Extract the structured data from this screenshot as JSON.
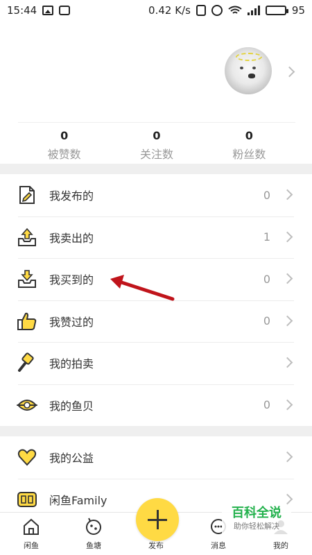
{
  "status_bar": {
    "time": "15:44",
    "speed": "0.42 K/s",
    "battery": "95"
  },
  "stats": [
    {
      "value": "0",
      "label": "被赞数"
    },
    {
      "value": "0",
      "label": "关注数"
    },
    {
      "value": "0",
      "label": "粉丝数"
    }
  ],
  "menu_group_1": [
    {
      "label": "我发布的",
      "count": "0",
      "icon": "document-edit-icon"
    },
    {
      "label": "我卖出的",
      "count": "1",
      "icon": "box-upload-icon"
    },
    {
      "label": "我买到的",
      "count": "0",
      "icon": "box-download-icon"
    },
    {
      "label": "我赞过的",
      "count": "0",
      "icon": "thumbs-up-icon"
    },
    {
      "label": "我的拍卖",
      "count": "",
      "icon": "gavel-icon"
    },
    {
      "label": "我的鱼贝",
      "count": "0",
      "icon": "shell-pearl-icon"
    }
  ],
  "menu_group_2": [
    {
      "label": "我的公益",
      "count": "",
      "icon": "heart-icon"
    },
    {
      "label": "闲鱼Family",
      "count": "",
      "icon": "family-badge-icon"
    }
  ],
  "tabbar": {
    "tabs": [
      {
        "label": "闲鱼",
        "icon": "home-icon"
      },
      {
        "label": "鱼塘",
        "icon": "pond-icon"
      },
      {
        "label": "发布",
        "icon": "plus-icon"
      },
      {
        "label": "消息",
        "icon": "message-icon"
      },
      {
        "label": "我的",
        "icon": "profile-icon"
      }
    ]
  },
  "watermark": {
    "title": "百科全说",
    "subtitle": "助你轻松解决"
  },
  "colors": {
    "accent": "#ffda44",
    "arrow": "#c0141b",
    "watermark": "#22b14c"
  }
}
